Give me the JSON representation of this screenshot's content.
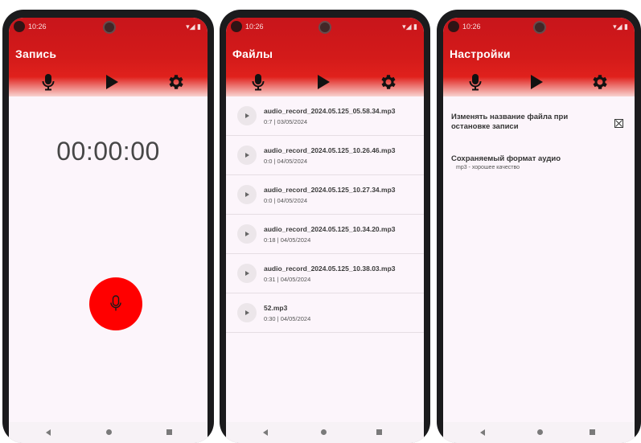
{
  "status": {
    "time": "10:26",
    "icons": "⚙ ▲",
    "signal": "▾◢ ▮"
  },
  "screens": {
    "record": {
      "title": "Запись",
      "timer": "00:00:00"
    },
    "files": {
      "title": "Файлы",
      "items": [
        {
          "name": "audio_record_2024.05.125_05.58.34.mp3",
          "meta": "0:7 | 03/05/2024"
        },
        {
          "name": "audio_record_2024.05.125_10.26.46.mp3",
          "meta": "0:0 | 04/05/2024"
        },
        {
          "name": "audio_record_2024.05.125_10.27.34.mp3",
          "meta": "0:0 | 04/05/2024"
        },
        {
          "name": "audio_record_2024.05.125_10.34.20.mp3",
          "meta": "0:18 | 04/05/2024"
        },
        {
          "name": "audio_record_2024.05.125_10.38.03.mp3",
          "meta": "0:31 | 04/05/2024"
        },
        {
          "name": "52.mp3",
          "meta": "0:30 | 04/05/2024"
        }
      ]
    },
    "settings": {
      "title": "Настройки",
      "rename_on_stop_label": "Изменять название файла при остановке записи",
      "rename_on_stop_checked": true,
      "format_label": "Сохраняемый формат аудио",
      "format_value": "mp3 - хорошее качество"
    }
  },
  "toolbar": {
    "icons": [
      "microphone-icon",
      "play-icon",
      "gear-icon"
    ]
  },
  "colors": {
    "header_red": "#d31a1a",
    "record_button": "#ff0000",
    "background": "#fcf5fb"
  }
}
